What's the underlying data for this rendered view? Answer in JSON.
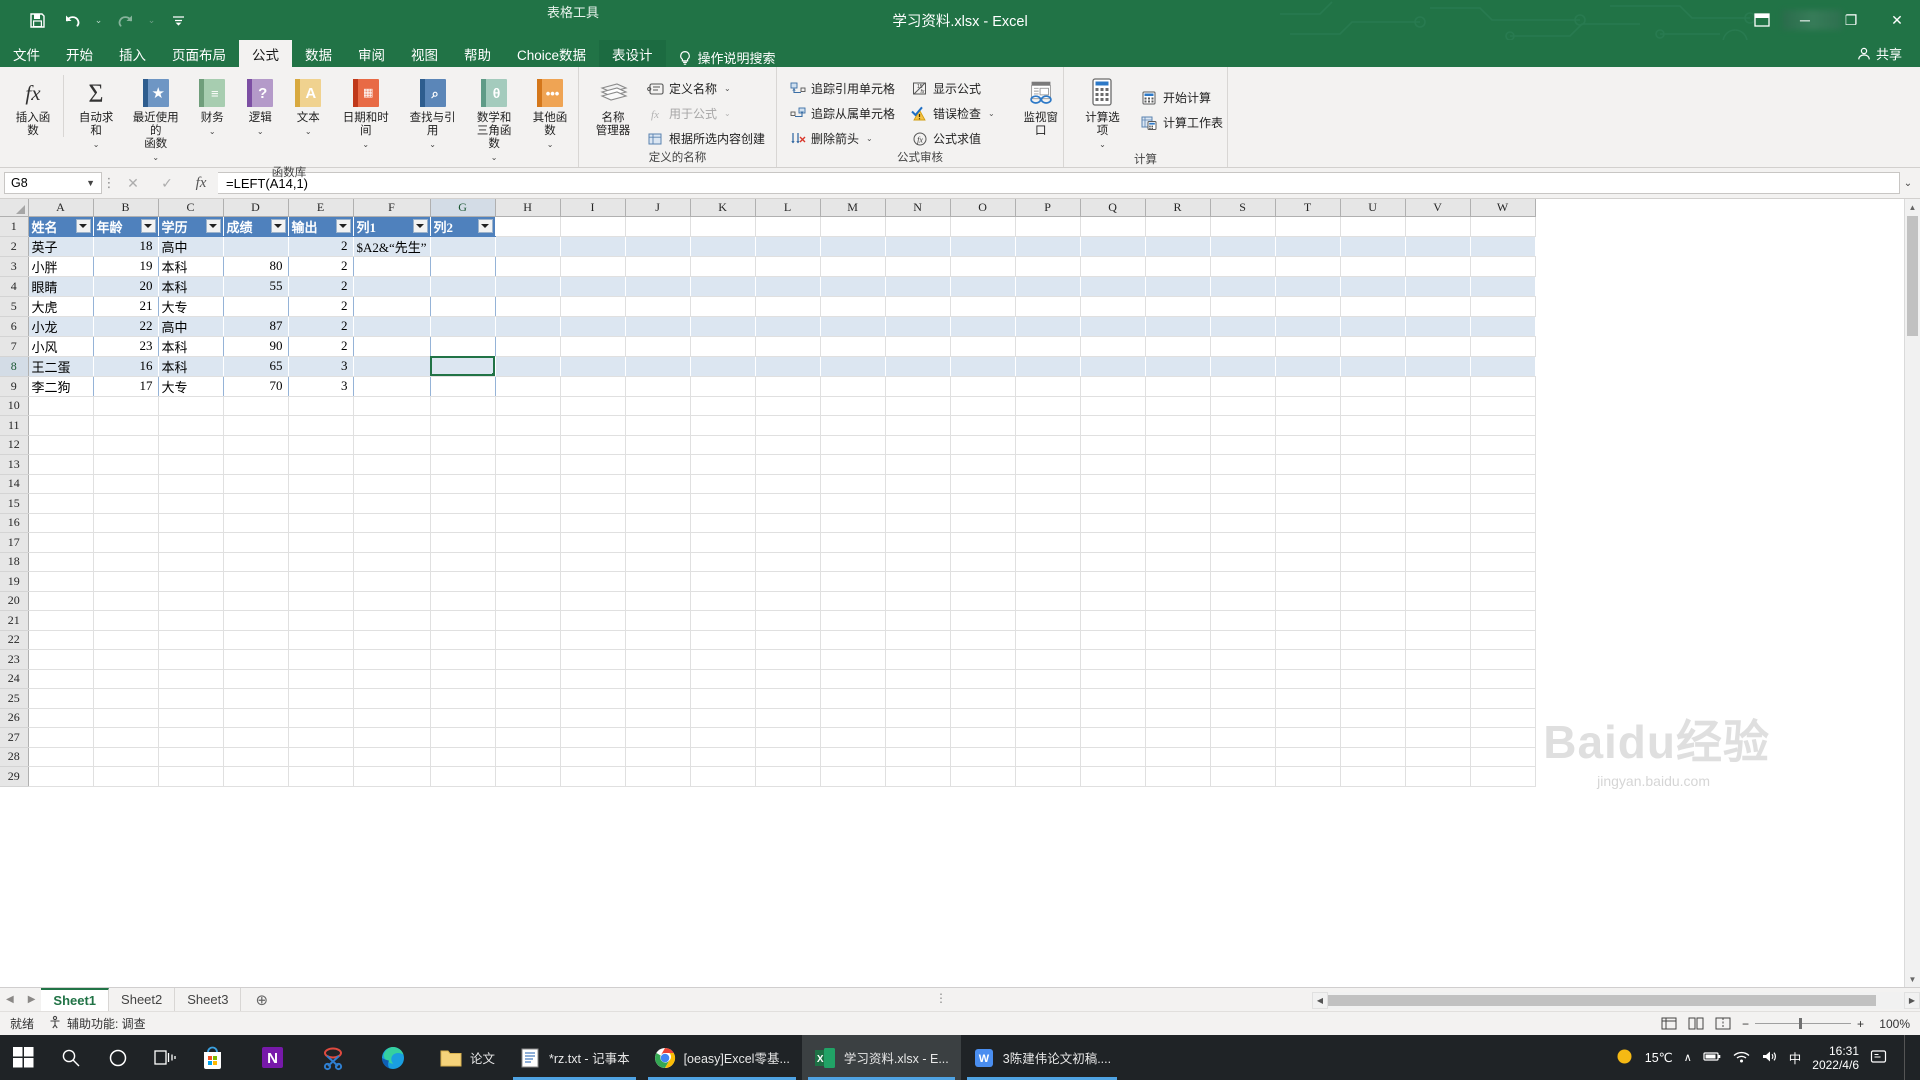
{
  "titlebar": {
    "filename": "学习资料.xlsx  -  Excel",
    "context_tab_label": "表格工具",
    "qat": [
      {
        "name": "save",
        "icon": "save-icon"
      },
      {
        "name": "undo",
        "icon": "undo-icon"
      },
      {
        "name": "redo",
        "icon": "redo-icon"
      },
      {
        "name": "customize",
        "icon": "customize-qat-icon"
      }
    ],
    "window_buttons": {
      "minimize": "─",
      "restore": "❐",
      "close": "✕",
      "ribbon_display": "▭"
    }
  },
  "tabs": [
    {
      "label": "文件",
      "active": false,
      "context": false
    },
    {
      "label": "开始",
      "active": false,
      "context": false
    },
    {
      "label": "插入",
      "active": false,
      "context": false
    },
    {
      "label": "页面布局",
      "active": false,
      "context": false
    },
    {
      "label": "公式",
      "active": true,
      "context": false
    },
    {
      "label": "数据",
      "active": false,
      "context": false
    },
    {
      "label": "审阅",
      "active": false,
      "context": false
    },
    {
      "label": "视图",
      "active": false,
      "context": false
    },
    {
      "label": "帮助",
      "active": false,
      "context": false
    },
    {
      "label": "Choice数据",
      "active": false,
      "context": false
    },
    {
      "label": "表设计",
      "active": false,
      "context": true
    }
  ],
  "tellme": "操作说明搜索",
  "share": "共享",
  "ribbon": {
    "groups": [
      {
        "title": "函数库",
        "buttons": [
          {
            "label": "插入函数",
            "icon": "insert-function-icon",
            "caret": false,
            "color": "none"
          },
          {
            "label": "自动求和",
            "icon": "autosum-icon",
            "caret": true,
            "color": "none"
          },
          {
            "label": "最近使用的\n函数",
            "icon": "recent-functions-icon",
            "caret": true,
            "color": "#4f81bd"
          },
          {
            "label": "财务",
            "icon": "financial-icon",
            "caret": true,
            "color": "#8db38b"
          },
          {
            "label": "逻辑",
            "icon": "logical-icon",
            "caret": true,
            "color": "#8e6cb0"
          },
          {
            "label": "文本",
            "icon": "text-icon",
            "caret": true,
            "color": "#e8b864"
          },
          {
            "label": "日期和时间",
            "icon": "date-time-icon",
            "caret": true,
            "color": "#d9512c"
          },
          {
            "label": "查找与引用",
            "icon": "lookup-reference-icon",
            "caret": true,
            "color": "#3f6fa8"
          },
          {
            "label": "数学和\n三角函数",
            "icon": "math-trig-icon",
            "caret": true,
            "color": "#74a892"
          },
          {
            "label": "其他函数",
            "icon": "more-functions-icon",
            "caret": true,
            "color": "#e08a2e"
          }
        ]
      },
      {
        "title": "定义的名称",
        "big": {
          "label": "名称\n管理器",
          "icon": "name-manager-icon"
        },
        "items": [
          {
            "label": "定义名称",
            "icon": "define-name-icon",
            "caret": true,
            "disabled": false
          },
          {
            "label": "用于公式",
            "icon": "use-in-formula-icon",
            "caret": true,
            "disabled": true
          },
          {
            "label": "根据所选内容创建",
            "icon": "create-from-selection-icon",
            "caret": false,
            "disabled": false
          }
        ]
      },
      {
        "title": "公式审核",
        "col1": [
          {
            "label": "追踪引用单元格",
            "icon": "trace-precedents-icon",
            "caret": false
          },
          {
            "label": "追踪从属单元格",
            "icon": "trace-dependents-icon",
            "caret": false
          },
          {
            "label": "删除箭头",
            "icon": "remove-arrows-icon",
            "caret": true
          }
        ],
        "col2": [
          {
            "label": "显示公式",
            "icon": "show-formulas-icon",
            "caret": false
          },
          {
            "label": "错误检查",
            "icon": "error-checking-icon",
            "caret": true
          },
          {
            "label": "公式求值",
            "icon": "evaluate-formula-icon",
            "caret": false
          }
        ],
        "watch": {
          "label": "监视窗口",
          "icon": "watch-window-icon"
        }
      },
      {
        "title": "计算",
        "big": {
          "label": "计算选项",
          "icon": "calculation-options-icon",
          "caret": true
        },
        "items": [
          {
            "label": "开始计算",
            "icon": "calculate-now-icon"
          },
          {
            "label": "计算工作表",
            "icon": "calculate-sheet-icon"
          }
        ]
      }
    ]
  },
  "formula_bar": {
    "name_box": "G8",
    "cancel_icon": "cancel-icon",
    "accept_icon": "accept-icon",
    "fx_icon": "insert-function-icon",
    "formula": "=LEFT(A14,1)",
    "expand_icon": "expand-formula-bar-icon"
  },
  "grid": {
    "columns": [
      "A",
      "B",
      "C",
      "D",
      "E",
      "F",
      "G",
      "H",
      "I",
      "J",
      "K",
      "L",
      "M",
      "N",
      "O",
      "P",
      "Q",
      "R",
      "S",
      "T",
      "U",
      "V",
      "W"
    ],
    "selected_column": "G",
    "selected_row": 8,
    "active_cell": "G8",
    "rows": [
      1,
      2,
      3,
      4,
      5,
      6,
      7,
      8,
      9,
      10,
      11,
      12,
      13,
      14,
      15,
      16,
      17,
      18,
      19,
      20,
      21,
      22,
      23,
      24,
      25,
      26,
      27,
      28,
      29
    ],
    "table_headers": [
      "姓名",
      "年龄",
      "学历",
      "成绩",
      "输出",
      "列1",
      "列2"
    ],
    "data": [
      {
        "row": 2,
        "A": "英子",
        "B": "18",
        "C": "高中",
        "D": "",
        "E": "2",
        "F": "$A2&“先生”",
        "G": ""
      },
      {
        "row": 3,
        "A": "小胖",
        "B": "19",
        "C": "本科",
        "D": "80",
        "E": "2",
        "F": "",
        "G": ""
      },
      {
        "row": 4,
        "A": "眼睛",
        "B": "20",
        "C": "本科",
        "D": "55",
        "E": "2",
        "F": "",
        "G": ""
      },
      {
        "row": 5,
        "A": "大虎",
        "B": "21",
        "C": "大专",
        "D": "",
        "E": "2",
        "F": "",
        "G": ""
      },
      {
        "row": 6,
        "A": "小龙",
        "B": "22",
        "C": "高中",
        "D": "87",
        "E": "2",
        "F": "",
        "G": ""
      },
      {
        "row": 7,
        "A": "小风",
        "B": "23",
        "C": "本科",
        "D": "90",
        "E": "2",
        "F": "",
        "G": ""
      },
      {
        "row": 8,
        "A": "王二蛋",
        "B": "16",
        "C": "本科",
        "D": "65",
        "E": "3",
        "F": "",
        "G": ""
      },
      {
        "row": 9,
        "A": "李二狗",
        "B": "17",
        "C": "大专",
        "D": "70",
        "E": "3",
        "F": "",
        "G": ""
      }
    ]
  },
  "sheet_tabs": {
    "tabs": [
      "Sheet1",
      "Sheet2",
      "Sheet3"
    ],
    "active": "Sheet1",
    "add_label": "+",
    "nav_prev": "◀",
    "nav_next": "▶"
  },
  "status_bar": {
    "state": "就绪",
    "accessibility": "辅助功能: 调查",
    "zoom": "100%",
    "zoom_out": "−",
    "zoom_in": "+",
    "views": [
      "normal-view-icon",
      "page-layout-view-icon",
      "page-break-view-icon"
    ]
  },
  "taskbar": {
    "system": [
      {
        "name": "start-button",
        "icon": "windows-logo-icon"
      },
      {
        "name": "search-button",
        "icon": "search-icon"
      },
      {
        "name": "cortana-button",
        "icon": "cortana-circle-icon"
      },
      {
        "name": "task-view-button",
        "icon": "task-view-icon"
      }
    ],
    "pinned": [
      {
        "name": "microsoft-store",
        "icon": "store-icon",
        "label": ""
      },
      {
        "name": "onenote",
        "icon": "onenote-icon",
        "label": ""
      },
      {
        "name": "snipping-tool",
        "icon": "snipping-tool-icon",
        "label": ""
      },
      {
        "name": "microsoft-edge",
        "icon": "edge-icon",
        "label": ""
      },
      {
        "name": "folder-lunwen",
        "icon": "folder-icon",
        "label": "论文"
      }
    ],
    "windows": [
      {
        "name": "notepad-window",
        "icon": "notepad-icon",
        "label": "*rz.txt - 记事本",
        "active": false
      },
      {
        "name": "chrome-window",
        "icon": "chrome-icon",
        "label": "[oeasy]Excel零基...",
        "active": false
      },
      {
        "name": "excel-window",
        "icon": "excel-icon",
        "label": "学习资料.xlsx - E...",
        "active": true
      },
      {
        "name": "wps-window",
        "icon": "wps-writer-icon",
        "label": "3陈建伟论文初稿....",
        "active": false
      }
    ],
    "tray": {
      "weather_temp": "15℃",
      "weather_icon": "sun-icon",
      "chevron": "∧",
      "icons": [
        "battery-icon",
        "network-icon",
        "volume-icon"
      ],
      "ime": "中",
      "time": "16:31",
      "date": "2022/4/6",
      "notification_icon": "notification-icon"
    }
  },
  "watermark": {
    "brand": "Baidu经验",
    "url": "jingyan.baidu.com"
  }
}
